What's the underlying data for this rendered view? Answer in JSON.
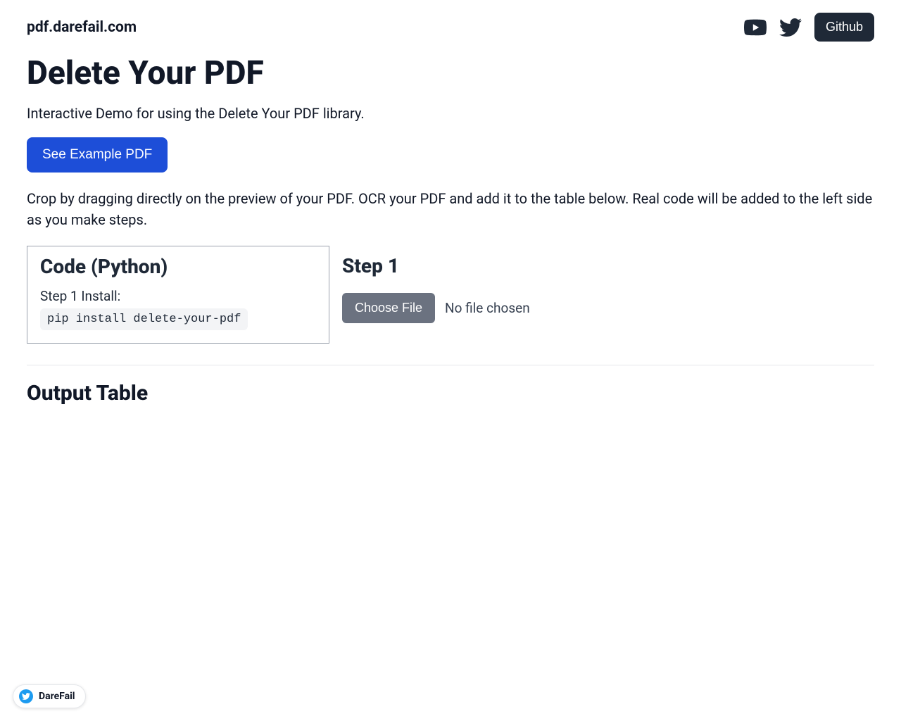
{
  "header": {
    "site_name": "pdf.darefail.com",
    "github_label": "Github"
  },
  "main": {
    "title": "Delete Your PDF",
    "subtitle": "Interactive Demo for using the Delete Your PDF library.",
    "example_btn": "See Example PDF",
    "description": "Crop by dragging directly on the preview of your PDF. OCR your PDF and add it to the table below. Real code will be added to the left side as you make steps."
  },
  "code_panel": {
    "heading": "Code (Python)",
    "step_label": "Step 1 Install:",
    "code": "pip install delete-your-pdf"
  },
  "step_panel": {
    "heading": "Step 1",
    "choose_file_label": "Choose File",
    "file_status": "No file chosen"
  },
  "output": {
    "heading": "Output Table"
  },
  "badge": {
    "text": "DareFail"
  }
}
